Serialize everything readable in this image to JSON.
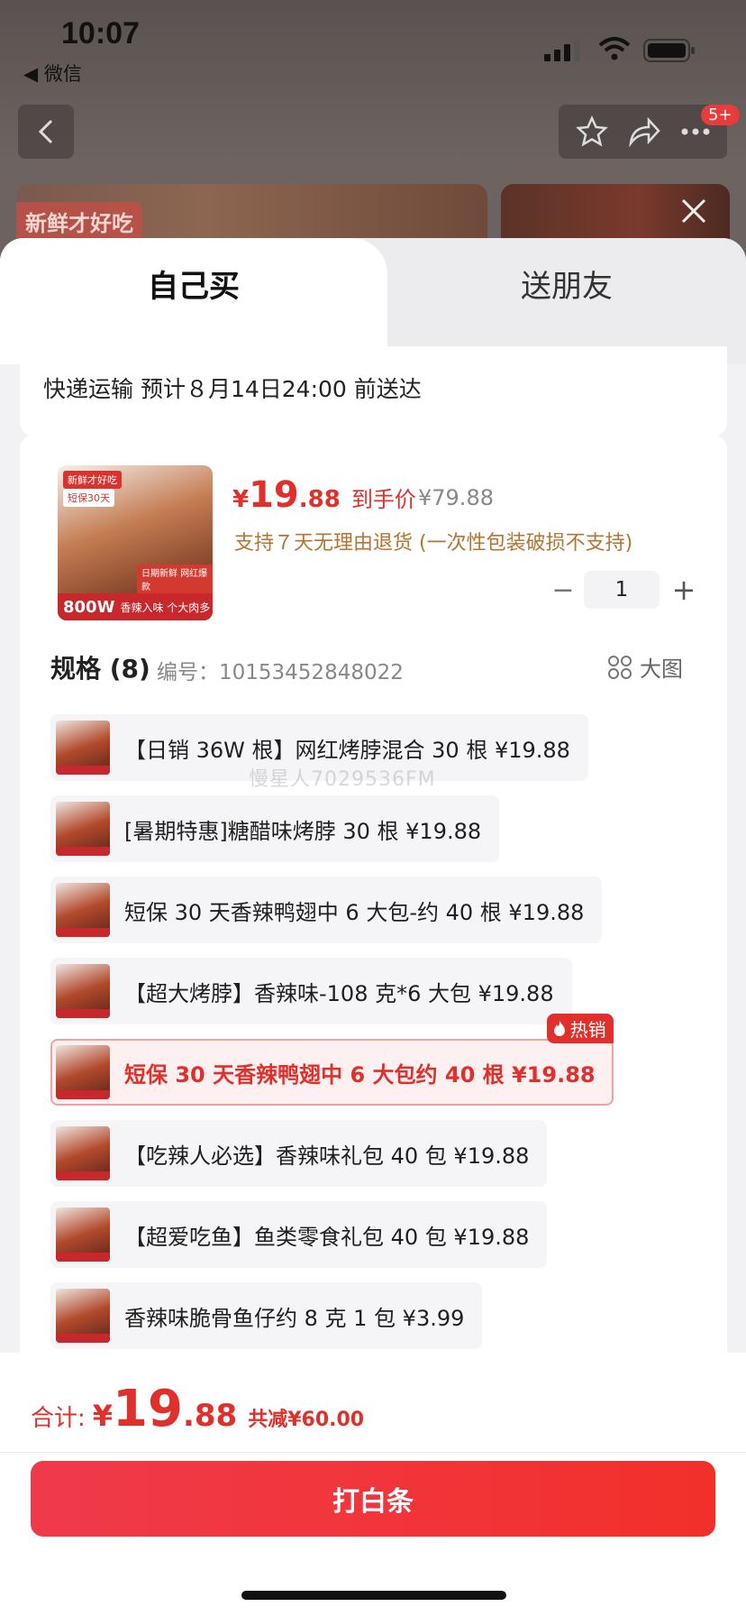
{
  "status_bar": {
    "time": "10:07",
    "back_app": "◀ 微信"
  },
  "nav": {
    "badge": "5+"
  },
  "hero": {
    "tag": "新鲜才好吃"
  },
  "tabs": {
    "self": "自己买",
    "friend": "送朋友"
  },
  "shipping": {
    "text": "快递运输 预计８月14日24:00 前送达"
  },
  "product": {
    "image_tag1": "新鲜才好吃",
    "image_tag2": "短保30天",
    "image_strip": "日期新鲜 网红爆款",
    "image_bottom_big": "800W",
    "image_bottom_text": "香辣入味 个大肉多",
    "price_yen": "¥",
    "price_int": "19",
    "price_dec": ".88",
    "price_label": "到手价",
    "original_price": "¥79.88",
    "refund_note": "支持７天无理由退货 (一次性包装破损不支持)",
    "quantity": "1"
  },
  "spec": {
    "title": "规格 (8)",
    "code": "编号：10153452848022",
    "big_image_label": "大图",
    "options": [
      {
        "label": "【日销 36W 根】网红烤脖混合 30 根  ¥19.88"
      },
      {
        "label": "[暑期特惠]糖醋味烤脖 30 根  ¥19.88"
      },
      {
        "label": "短保 30 天香辣鸭翅中 6 大包-约 40 根  ¥19.88"
      },
      {
        "label": "【超大烤脖】香辣味-108 克*6 大包  ¥19.88"
      },
      {
        "label": "短保 30 天香辣鸭翅中 6 大包约 40 根  ¥19.88",
        "selected": true
      },
      {
        "label": "【吃辣人必选】香辣味礼包 40 包  ¥19.88"
      },
      {
        "label": "【超爱吃鱼】鱼类零食礼包 40 包  ¥19.88"
      },
      {
        "label": "香辣味脆骨鱼仔约 8 克 1 包  ¥3.99"
      }
    ],
    "hot_badge": "热销"
  },
  "watermark": "慢星人7029536FM",
  "summary": {
    "label": "合计:",
    "yen": "¥",
    "int": "19",
    "dec": ".88",
    "saved": "共减¥60.00"
  },
  "pay_button": "打白条",
  "colors": {
    "accent": "#e1302b",
    "refund_text": "#b57432"
  }
}
